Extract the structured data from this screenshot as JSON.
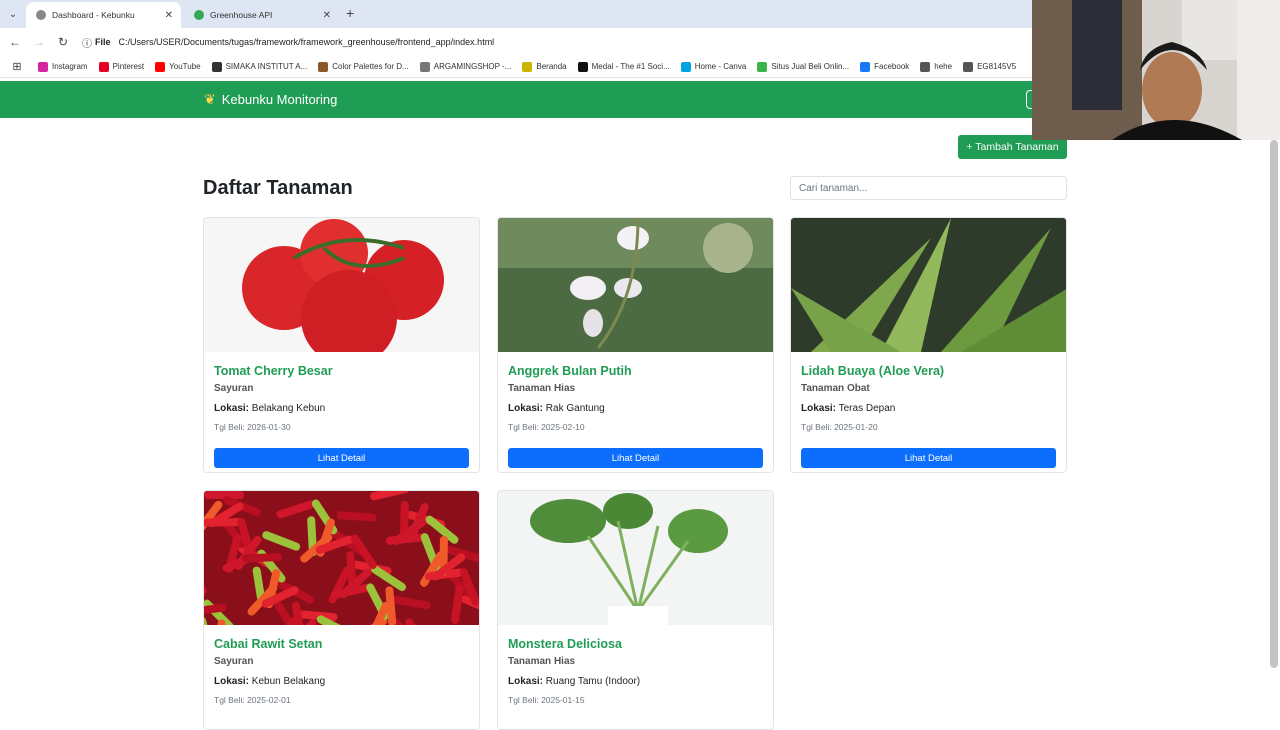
{
  "browser": {
    "tabs": [
      {
        "label": "Dashboard - Kebunku",
        "active": true
      },
      {
        "label": "Greenhouse API",
        "active": false
      }
    ],
    "address": {
      "scheme": "File",
      "url": "C:/Users/USER/Documents/tugas/framework/framework_greenhouse/frontend_app/index.html"
    },
    "bookmarks": [
      {
        "label": "Instagram",
        "color": "#d6249f"
      },
      {
        "label": "Pinterest",
        "color": "#e60023"
      },
      {
        "label": "YouTube",
        "color": "#ff0000"
      },
      {
        "label": "SIMAKA INSTITUT A...",
        "color": "#333333"
      },
      {
        "label": "Color Palettes for D...",
        "color": "#8a5a2b"
      },
      {
        "label": "ARGAMINGSHOP -...",
        "color": "#777777"
      },
      {
        "label": "Beranda",
        "color": "#c9b400"
      },
      {
        "label": "Medal - The #1 Soci...",
        "color": "#111111"
      },
      {
        "label": "Home - Canva",
        "color": "#00a3e0"
      },
      {
        "label": "Situs Jual Beli Onlin...",
        "color": "#3bb54a"
      },
      {
        "label": "Facebook",
        "color": "#1877f2"
      },
      {
        "label": "hehe",
        "color": "#555555"
      },
      {
        "label": "EG8145V5",
        "color": "#555555"
      }
    ]
  },
  "app": {
    "brand": "Kebunku Monitoring",
    "add_button": "+ Tambah Tanaman",
    "title": "Daftar Tanaman",
    "search_placeholder": "Cari tanaman...",
    "location_label": "Lokasi:",
    "detail_label": "Lihat Detail",
    "colors": {
      "primary_green": "#1f9d55",
      "button_blue": "#0d6efd"
    }
  },
  "plants": [
    {
      "name": "Tomat Cherry Besar",
      "category": "Sayuran",
      "location": "Belakang Kebun",
      "date": "Tgl Beli: 2026-01-30",
      "image": "tomato"
    },
    {
      "name": "Anggrek Bulan Putih",
      "category": "Tanaman Hias",
      "location": "Rak Gantung",
      "date": "Tgl Beli: 2025-02-10",
      "image": "orchid"
    },
    {
      "name": "Lidah Buaya (Aloe Vera)",
      "category": "Tanaman Obat",
      "location": "Teras Depan",
      "date": "Tgl Beli: 2025-01-20",
      "image": "aloe"
    },
    {
      "name": "Cabai Rawit Setan",
      "category": "Sayuran",
      "location": "Kebun Belakang",
      "date": "Tgl Beli: 2025-02-01",
      "image": "chili"
    },
    {
      "name": "Monstera Deliciosa",
      "category": "Tanaman Hias",
      "location": "Ruang Tamu (Indoor)",
      "date": "Tgl Beli: 2025-01-15",
      "image": "monstera"
    }
  ]
}
